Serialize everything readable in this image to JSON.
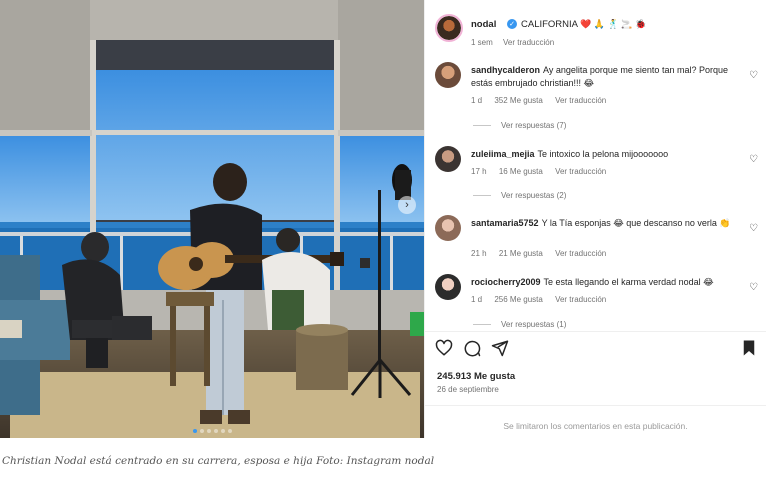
{
  "post": {
    "owner": "nodal",
    "caption": "CALIFORNIA",
    "caption_emojis": "❤️ 🙏 🕺 🚬 🐞",
    "time": "1 sem",
    "translate": "Ver traducción"
  },
  "comments": [
    {
      "user": "sandhycalderon",
      "text": "Ay angelita porque me siento tan mal? Porque estás embrujado christian!!! 😂",
      "time": "1 d",
      "likes": "352 Me gusta",
      "translate": "Ver traducción",
      "replies": "Ver respuestas (7)"
    },
    {
      "user": "zuleiima_mejia",
      "text": "Te intoxico la pelona mijooooooo",
      "time": "17 h",
      "likes": "16 Me gusta",
      "translate": "Ver traducción",
      "replies": "Ver respuestas (2)"
    },
    {
      "user": "santamaria5752",
      "text": "Y la Tía esponjas 😂 que descanso no verla 👏",
      "time": "21 h",
      "likes": "21 Me gusta",
      "translate": "Ver traducción",
      "replies": ""
    },
    {
      "user": "rociocherry2009",
      "text": "Te esta llegando el karma verdad nodal 😂",
      "time": "1 d",
      "likes": "256 Me gusta",
      "translate": "Ver traducción",
      "replies": "Ver respuestas (1)"
    }
  ],
  "actions": {
    "like_icon": "heart-icon",
    "comment_icon": "comment-icon",
    "share_icon": "send-icon",
    "save_icon": "bookmark-icon"
  },
  "stats": {
    "likes": "245.913 Me gusta",
    "date": "26 de septiembre"
  },
  "limited_notice": "Se limitaron los comentarios en esta publicación.",
  "figure_caption": "Christian Nodal está centrado en su carrera, esposa e hija Foto: Instagram nodal",
  "carousel": {
    "total": 6,
    "active": 0
  },
  "colors": {
    "verified": "#3897f0",
    "muted": "#737373",
    "text": "#262626",
    "sky": "#4f9de6",
    "sea": "#1f6fb6"
  }
}
